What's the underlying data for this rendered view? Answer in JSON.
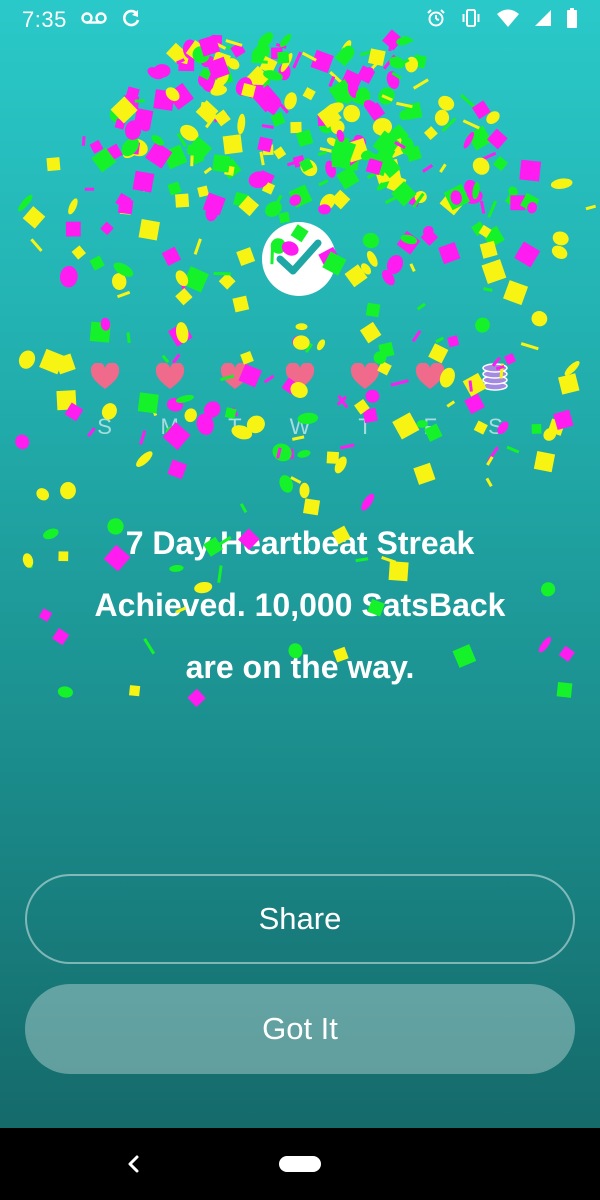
{
  "status_bar": {
    "time": "7:35",
    "left_icons": [
      "voicemail-icon",
      "sync-icon"
    ],
    "right_icons": [
      "alarm-icon",
      "vibrate-icon",
      "wifi-icon",
      "cellular-icon",
      "battery-icon"
    ]
  },
  "streak": {
    "badge_icon": "checkmark-icon",
    "days": [
      {
        "letter": "S",
        "icon": "heart-icon"
      },
      {
        "letter": "M",
        "icon": "heart-icon"
      },
      {
        "letter": "T",
        "icon": "heart-icon"
      },
      {
        "letter": "W",
        "icon": "heart-icon"
      },
      {
        "letter": "T",
        "icon": "heart-icon"
      },
      {
        "letter": "F",
        "icon": "heart-icon"
      },
      {
        "letter": "S",
        "icon": "coin-stack-icon"
      }
    ]
  },
  "message": "7 Day Heartbeat Streak\nAchieved. 10,000 SatsBack\nare on the way.",
  "buttons": {
    "share": "Share",
    "got_it": "Got It"
  },
  "colors": {
    "background_top": "#2ac9c9",
    "background_bottom": "#156a6a",
    "heart": "#f06a8c",
    "coin": "#a28be0",
    "confetti": [
      "#ff1cf0",
      "#f7f414",
      "#16f22a"
    ]
  },
  "nav_bar": {
    "icons": [
      "back-icon",
      "home-icon"
    ]
  }
}
